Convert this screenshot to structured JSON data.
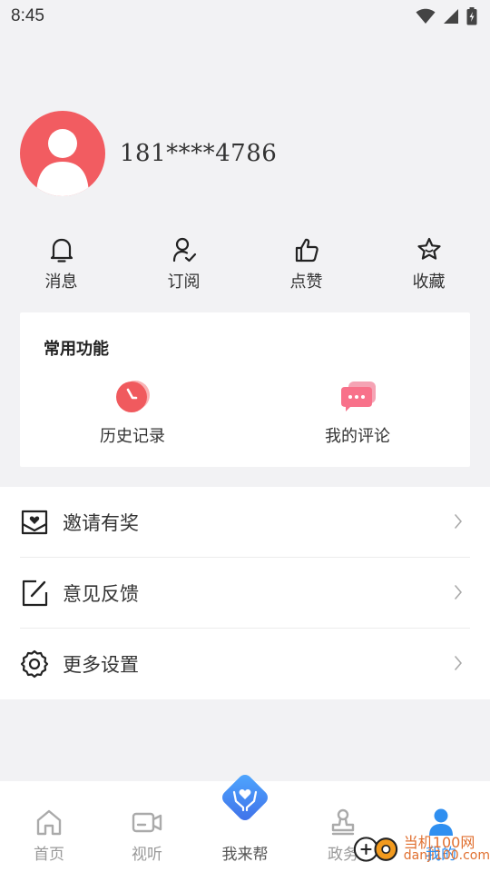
{
  "status_bar": {
    "time": "8:45"
  },
  "profile": {
    "phone": "181****4786"
  },
  "quick_actions": [
    {
      "label": "消息",
      "icon": "bell-icon"
    },
    {
      "label": "订阅",
      "icon": "user-check-icon"
    },
    {
      "label": "点赞",
      "icon": "thumbs-up-icon"
    },
    {
      "label": "收藏",
      "icon": "star-icon"
    }
  ],
  "common_functions": {
    "title": "常用功能",
    "items": [
      {
        "label": "历史记录",
        "icon": "history-icon"
      },
      {
        "label": "我的评论",
        "icon": "comment-icon"
      }
    ]
  },
  "menu": [
    {
      "label": "邀请有奖",
      "icon": "gift-envelope-icon"
    },
    {
      "label": "意见反馈",
      "icon": "edit-icon"
    },
    {
      "label": "更多设置",
      "icon": "settings-icon"
    }
  ],
  "tab_bar": [
    {
      "label": "首页",
      "icon": "home-icon"
    },
    {
      "label": "视听",
      "icon": "video-icon"
    },
    {
      "label": "我来帮",
      "icon": "help-hands-icon"
    },
    {
      "label": "政务",
      "icon": "stamp-icon"
    },
    {
      "label": "我的",
      "icon": "person-icon",
      "active": true
    }
  ],
  "watermark": {
    "text_line1": "当机100网",
    "text_line2": "danji100.com"
  },
  "colors": {
    "accent": "#2f8ff0",
    "avatar": "#f25c61",
    "history_icon": "#f05a5e",
    "comment_icon": "#f8718a"
  }
}
